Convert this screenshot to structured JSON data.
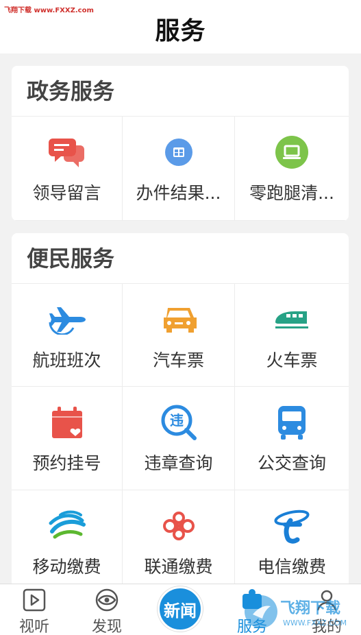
{
  "watermark": "飞翔下载 www.FXXZ.com",
  "page_title": "服务",
  "gov_section": {
    "title": "政务服务",
    "items": [
      {
        "label": "领导留言",
        "icon": "chat-bubbles-icon",
        "color": "#e8534a"
      },
      {
        "label": "办件结果...",
        "icon": "grid-window-icon",
        "color": "#5b9be8"
      },
      {
        "label": "零跑腿清...",
        "icon": "laptop-icon",
        "color": "#7dc44a"
      }
    ]
  },
  "civil_section": {
    "title": "便民服务",
    "items": [
      {
        "label": "航班班次",
        "icon": "airplane-icon",
        "color": "#2c8be0"
      },
      {
        "label": "汽车票",
        "icon": "car-icon",
        "color": "#f0a030"
      },
      {
        "label": "火车票",
        "icon": "train-icon",
        "color": "#27a286"
      },
      {
        "label": "预约挂号",
        "icon": "calendar-heart-icon",
        "color": "#e8534a"
      },
      {
        "label": "违章查询",
        "icon": "violation-search-icon",
        "color": "#2c8be0"
      },
      {
        "label": "公交查询",
        "icon": "bus-icon",
        "color": "#2c8be0"
      },
      {
        "label": "移动缴费",
        "icon": "china-mobile-icon",
        "color": "#1a9dd9"
      },
      {
        "label": "联通缴费",
        "icon": "china-unicom-icon",
        "color": "#e8534a"
      },
      {
        "label": "电信缴费",
        "icon": "china-telecom-icon",
        "color": "#1a7fd6"
      }
    ]
  },
  "tabbar": {
    "tabs": [
      {
        "label": "视听",
        "icon": "play-video-icon"
      },
      {
        "label": "发现",
        "icon": "eye-icon"
      },
      {
        "label": "新闻",
        "icon": "news-center-button"
      },
      {
        "label": "服务",
        "icon": "service-icon",
        "active": true
      },
      {
        "label": "我的",
        "icon": "user-icon"
      }
    ],
    "active_color": "#1a8fdc"
  },
  "corner_watermark": {
    "text": "飞翔下载",
    "url": "WWW.FXXZ.COM"
  }
}
